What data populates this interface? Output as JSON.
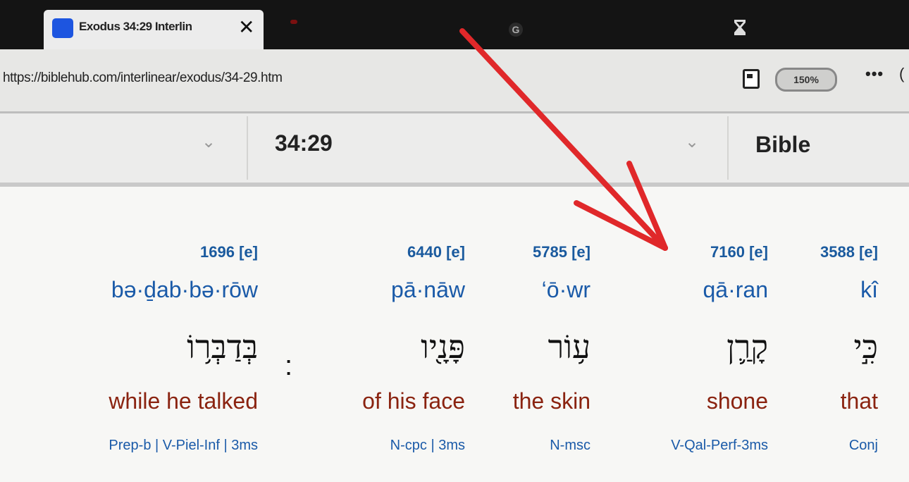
{
  "browser": {
    "tab_title": "Exodus 34:29 Interlin",
    "tab_close": "✕",
    "google_glyph": "G",
    "url": "https://biblehub.com/interlinear/exodus/34-29.htm",
    "zoom": "150%",
    "more": "•••"
  },
  "nav": {
    "verse": "34:29",
    "version": "Bible"
  },
  "interlinear": {
    "words": [
      {
        "strong": "3588 [e]",
        "translit": "kî",
        "hebrew": "כִּ֣י",
        "english": "that",
        "parse": "Conj"
      },
      {
        "strong": "7160 [e]",
        "translit": "qā·ran",
        "hebrew": "קָרַ֛ן",
        "english": "shone",
        "parse": "V-Qal-Perf-3ms"
      },
      {
        "strong": "5785 [e]",
        "translit": "‘ō·wr",
        "hebrew": "ע֥וֹר",
        "english": "the skin",
        "parse": "N-msc"
      },
      {
        "strong": "6440 [e]",
        "translit": "pā·nāw",
        "hebrew": "פָּנָ֖יו",
        "english": "of his face",
        "parse": "N-cpc | 3ms"
      },
      {
        "strong": "1696 [e]",
        "translit": "bə·ḏab·bə·rōw",
        "hebrew": "בְּדַבְּר֥וֹ",
        "english": "while he talked",
        "parse": "Prep-b | V-Piel-Inf | 3ms"
      }
    ],
    "punctuation": "׃"
  },
  "colors": {
    "strong": "#1a5a9e",
    "translit": "#1a5aa8",
    "english": "#8a2310",
    "arrow": "#e0282a",
    "favicon": "#1d55e0"
  }
}
